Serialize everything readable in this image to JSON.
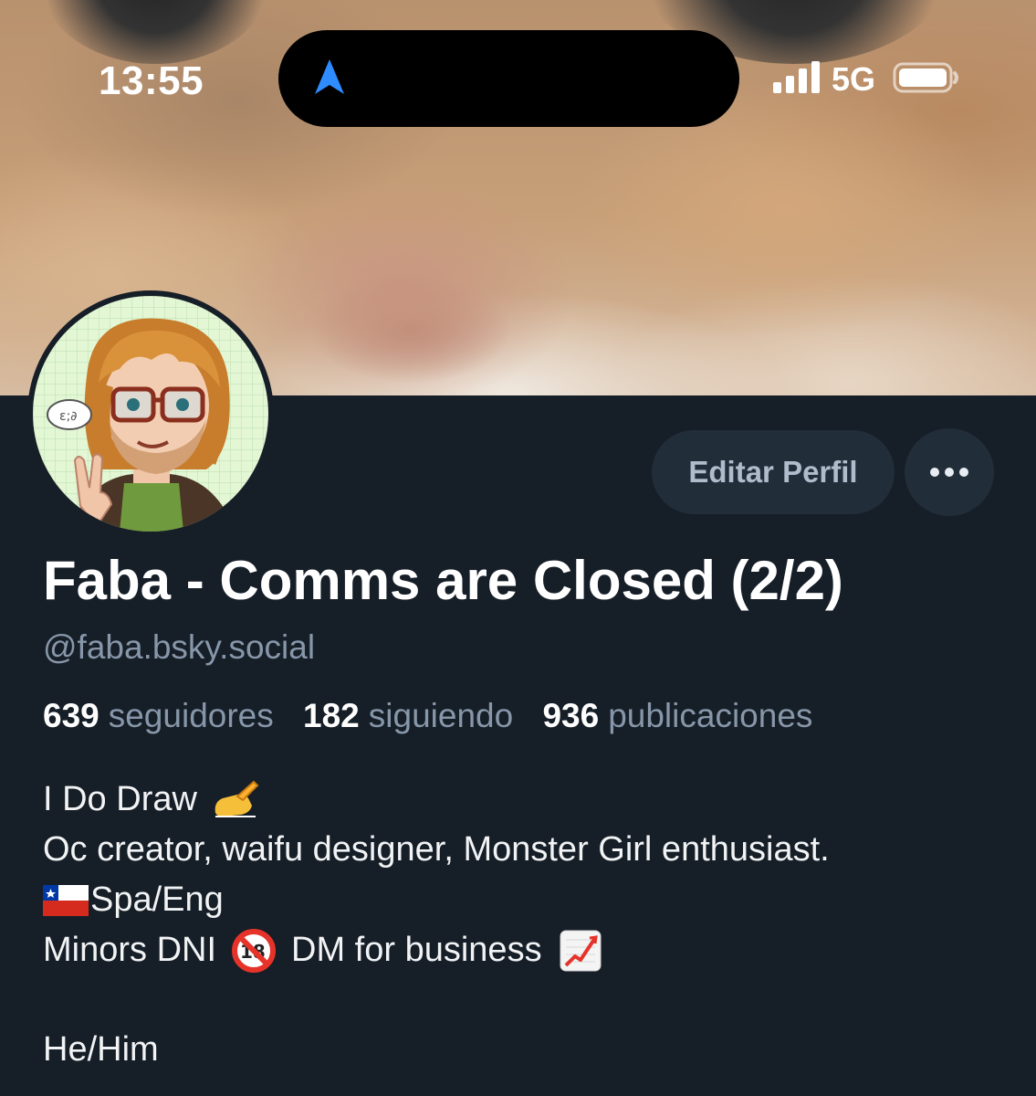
{
  "status_bar": {
    "time": "13:55",
    "network": "5G",
    "icons": [
      "navigation-arrow-icon",
      "signal-bars-icon",
      "battery-icon"
    ]
  },
  "profile": {
    "display_name": "Faba - Comms are Closed (2/2)",
    "handle": "@faba.bsky.social",
    "stats": [
      {
        "count": "639",
        "label": "seguidores"
      },
      {
        "count": "182",
        "label": "siguiendo"
      },
      {
        "count": "936",
        "label": "publicaciones"
      }
    ],
    "bio": {
      "line1": "I Do Draw",
      "line2": "Oc creator, waifu designer, Monster Girl enthusiast.",
      "line3": "Spa/Eng",
      "line4a": "Minors DNI",
      "line4b": "DM for business",
      "line5": "He/Him",
      "emojis": [
        "writing-hand-emoji",
        "chile-flag-emoji",
        "no-one-under-18-emoji",
        "chart-increasing-emoji"
      ]
    }
  },
  "actions": {
    "edit_profile": "Editar Perfil",
    "more_icon": "more-horizontal-icon"
  },
  "colors": {
    "background": "#161e27",
    "button_bg": "#222d3a",
    "button_text": "#afbccb",
    "muted_text": "#8797a9",
    "nav_arrow": "#2f8cff"
  }
}
